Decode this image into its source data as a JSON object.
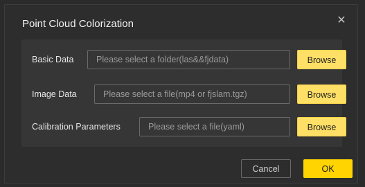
{
  "dialog": {
    "title": "Point Cloud Colorization",
    "close_glyph": "✕"
  },
  "rows": [
    {
      "label": "Basic Data",
      "placeholder": "Please select a folder(las&&fjdata)",
      "button": "Browse"
    },
    {
      "label": "Image Data",
      "placeholder": "Please select a file(mp4 or fjslam.tgz)",
      "button": "Browse"
    },
    {
      "label": "Calibration Parameters",
      "placeholder": "Please select a file(yaml)",
      "button": "Browse"
    }
  ],
  "footer": {
    "cancel": "Cancel",
    "ok": "OK"
  },
  "colors": {
    "accent": "#ffd400",
    "browse": "#ffe066",
    "background": "#2d2d2d",
    "panel": "#363636"
  },
  "icons": {
    "close": "close-icon"
  }
}
